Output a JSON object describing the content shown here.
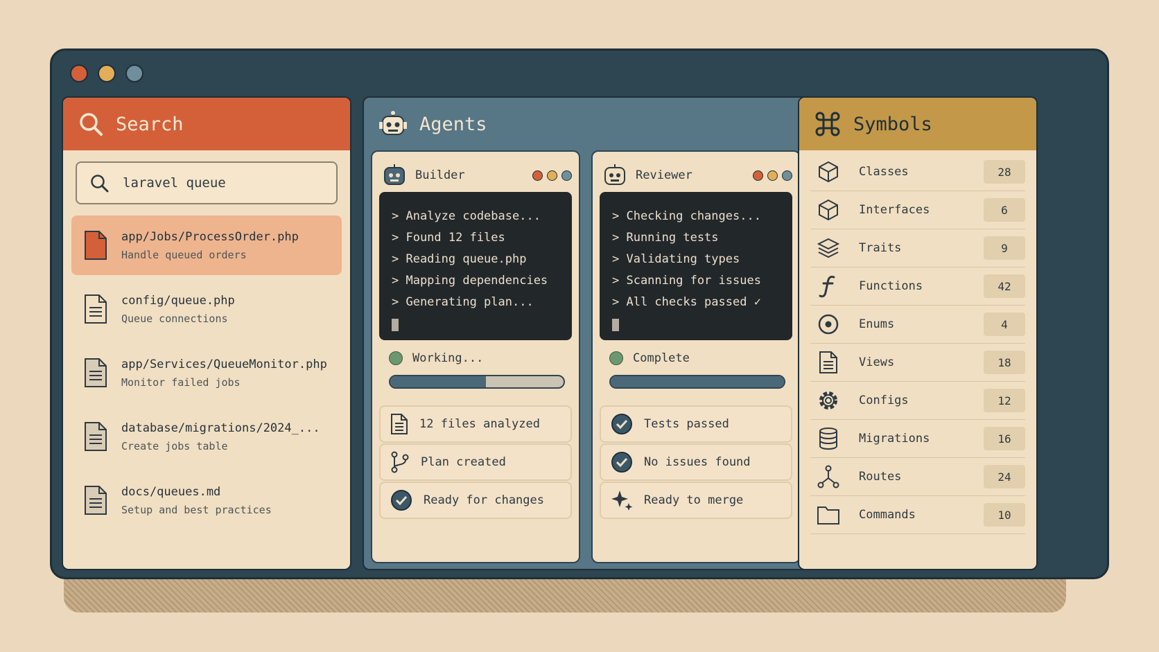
{
  "window": {
    "controls": {
      "close_color": "#d4603a",
      "minimize_color": "#e3ae5a",
      "maximize_color": "#6f8f9c"
    }
  },
  "search": {
    "title": "Search",
    "query": "laravel queue",
    "results": [
      {
        "path": "app/Jobs/ProcessOrder.php",
        "desc": "Handle queued orders",
        "active": true
      },
      {
        "path": "config/queue.php",
        "desc": "Queue connections"
      },
      {
        "path": "app/Services/QueueMonitor.php",
        "desc": "Monitor failed jobs"
      },
      {
        "path": "database/migrations/2024_...",
        "desc": "Create jobs table"
      },
      {
        "path": "docs/queues.md",
        "desc": "Setup and best practices"
      }
    ]
  },
  "agents": {
    "title": "Agents",
    "list": [
      {
        "name": "Builder",
        "log": [
          "> Analyze codebase...",
          "> Found 12 files",
          "> Reading queue.php",
          "> Mapping dependencies",
          "> Generating plan..."
        ],
        "status": "Working...",
        "progress": 0.55,
        "items": [
          {
            "icon": "document-icon",
            "label": "12 files analyzed"
          },
          {
            "icon": "branch-icon",
            "label": "Plan created"
          },
          {
            "icon": "check-circle-icon",
            "label": "Ready for changes"
          }
        ]
      },
      {
        "name": "Reviewer",
        "log": [
          "> Checking changes...",
          "> Running tests",
          "> Validating types",
          "> Scanning for issues",
          "> All checks passed ✓"
        ],
        "status": "Complete",
        "progress": 1.0,
        "items": [
          {
            "icon": "check-circle-icon",
            "label": "Tests passed"
          },
          {
            "icon": "check-circle-icon",
            "label": "No issues found"
          },
          {
            "icon": "sparkle-icon",
            "label": "Ready to merge"
          }
        ]
      }
    ]
  },
  "symbols": {
    "title": "Symbols",
    "items": [
      {
        "icon": "cube-icon",
        "label": "Classes",
        "count": "28"
      },
      {
        "icon": "cube-icon",
        "label": "Interfaces",
        "count": "6"
      },
      {
        "icon": "layers-icon",
        "label": "Traits",
        "count": "9"
      },
      {
        "icon": "function-icon",
        "label": "Functions",
        "count": "42"
      },
      {
        "icon": "target-icon",
        "label": "Enums",
        "count": "4"
      },
      {
        "icon": "document-icon",
        "label": "Views",
        "count": "18"
      },
      {
        "icon": "gear-icon",
        "label": "Configs",
        "count": "12"
      },
      {
        "icon": "database-icon",
        "label": "Migrations",
        "count": "16"
      },
      {
        "icon": "routes-icon",
        "label": "Routes",
        "count": "24"
      },
      {
        "icon": "folder-icon",
        "label": "Commands",
        "count": "10"
      }
    ]
  },
  "colors": {
    "accent_search": "#d4603a",
    "accent_agents": "#577686",
    "accent_symbols": "#c39848",
    "status_green": "#6c9770"
  }
}
